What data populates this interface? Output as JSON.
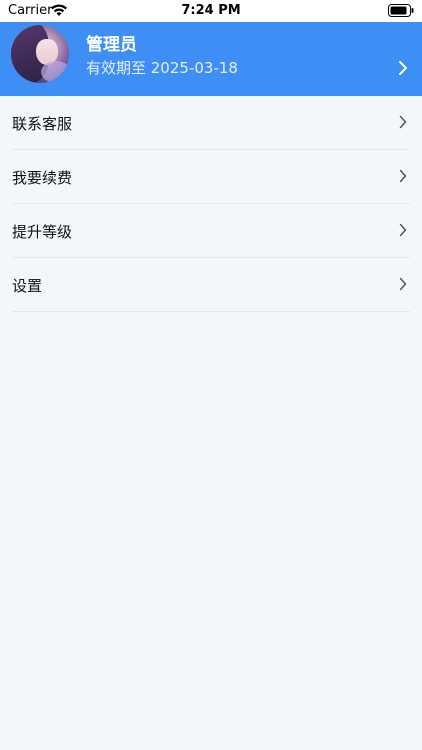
{
  "status_bar": {
    "carrier": "Carrier",
    "time": "7:24 PM",
    "icons": [
      "wifi-icon",
      "battery-icon"
    ]
  },
  "header": {
    "name": "管理员",
    "expiry": "有效期至 2025-03-18",
    "background_color": "#3d8ff6",
    "icons": [
      "avatar",
      "chevron-right-icon"
    ]
  },
  "menu": {
    "items": [
      {
        "label": "联系客服"
      },
      {
        "label": "我要续费"
      },
      {
        "label": "提升等级"
      },
      {
        "label": "设置"
      }
    ]
  },
  "colors": {
    "page_background": "#f3f7fb",
    "divider": "#e3e7ec"
  }
}
